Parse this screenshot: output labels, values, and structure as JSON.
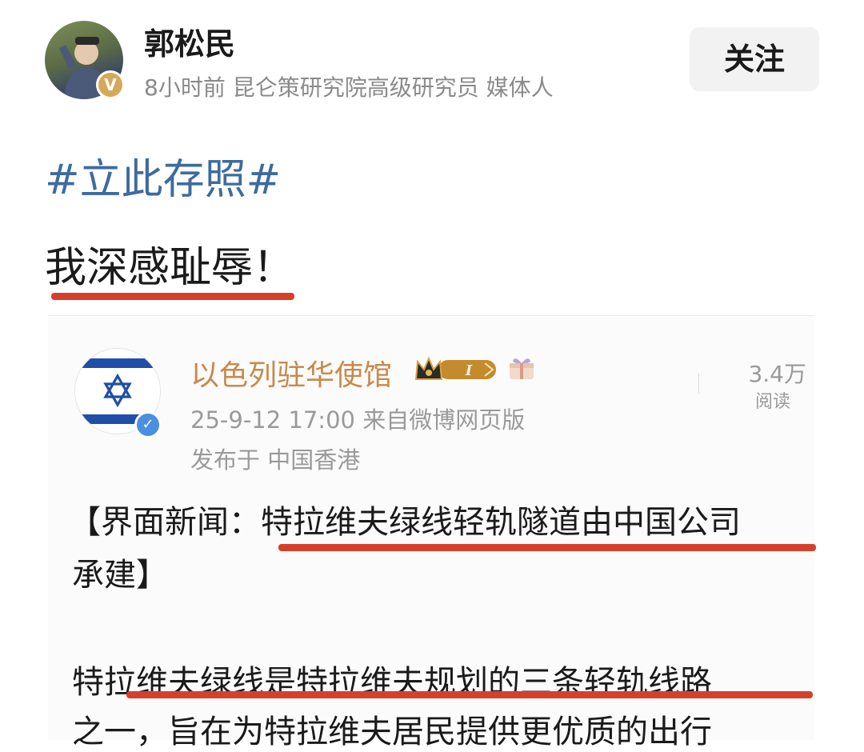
{
  "author": {
    "name": "郭松民",
    "meta": "8小时前  昆仑策研究院高级研究员 媒体人",
    "verified_badge": "V"
  },
  "follow_button": {
    "label": "关注"
  },
  "post": {
    "hashtag": "#立此存照#",
    "headline": "我深感耻辱！"
  },
  "repost": {
    "account_name": "以色列驻华使馆",
    "verified_badge": "✓",
    "reads_count": "3.4万",
    "reads_label": "阅读",
    "time_source": "25-9-12 17:00  来自微博网页版",
    "location": "发布于 中国香港",
    "paragraph1_line1": "【界面新闻：特拉维夫绿线轻轨隧道由中国公司",
    "paragraph1_line2": "承建】",
    "paragraph2_line1": "特拉维夫绿线是特拉维夫规划的三条轻轨线路",
    "paragraph2_line2": "之一，旨在为特拉维夫居民提供更优质的出行"
  },
  "colors": {
    "hashtag": "#3d6b9e",
    "underline": "#d6402a",
    "embassy_name": "#c9894a",
    "israel_blue": "#1f4fa8",
    "verified_blue": "#4a8fe0",
    "author_badge": "#d6a85a"
  },
  "icons": {
    "crown": "crown-level-badge-icon",
    "gift": "gift-box-icon",
    "flag": "israel-flag-icon"
  }
}
